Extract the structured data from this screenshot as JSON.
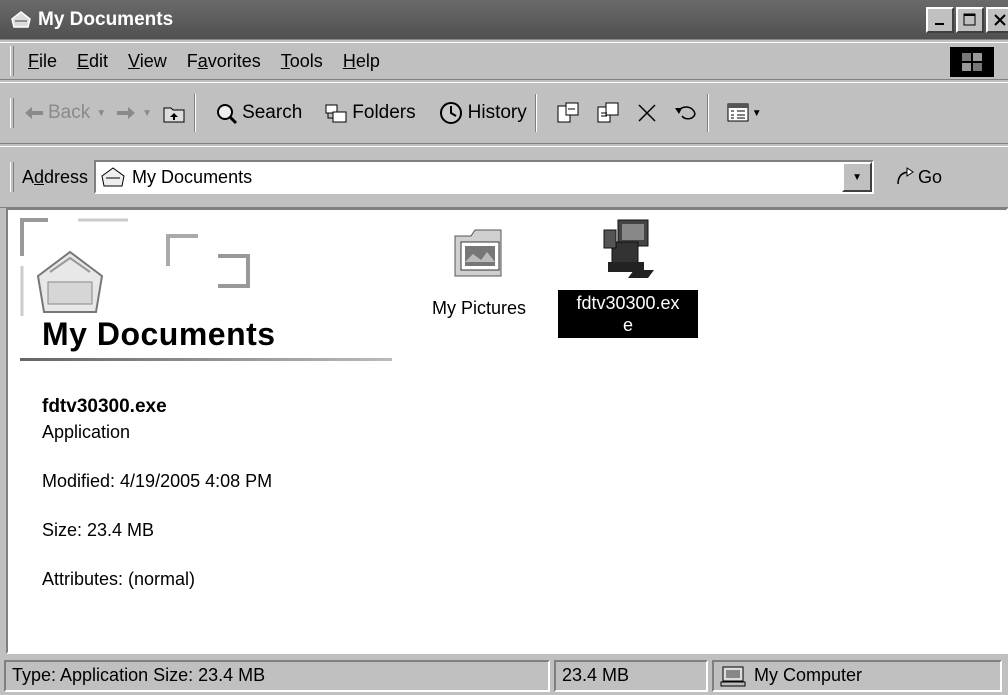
{
  "window": {
    "title": "My Documents"
  },
  "menu": [
    "File",
    "Edit",
    "View",
    "Favorites",
    "Tools",
    "Help"
  ],
  "menu_mnemonics": [
    "F",
    "E",
    "V",
    "a",
    "T",
    "H"
  ],
  "toolbar": {
    "back": "Back",
    "search": "Search",
    "folders": "Folders",
    "history": "History"
  },
  "address": {
    "label": "Address",
    "value": "My Documents",
    "go": "Go"
  },
  "sidebar": {
    "title": "My Documents",
    "selected_name": "fdtv30300.exe",
    "selected_type": "Application",
    "modified": "Modified: 4/19/2005 4:08 PM",
    "size": "Size: 23.4 MB",
    "attributes": "Attributes: (normal)"
  },
  "files": [
    {
      "label": "My Pictures",
      "icon": "pictures-folder-icon",
      "selected": false
    },
    {
      "label_line1": "fdtv30300.ex",
      "label_line2": "e",
      "icon": "installer-exe-icon",
      "selected": true
    }
  ],
  "status": {
    "info": "Type: Application Size: 23.4 MB",
    "size": "23.4 MB",
    "zone": "My Computer"
  }
}
